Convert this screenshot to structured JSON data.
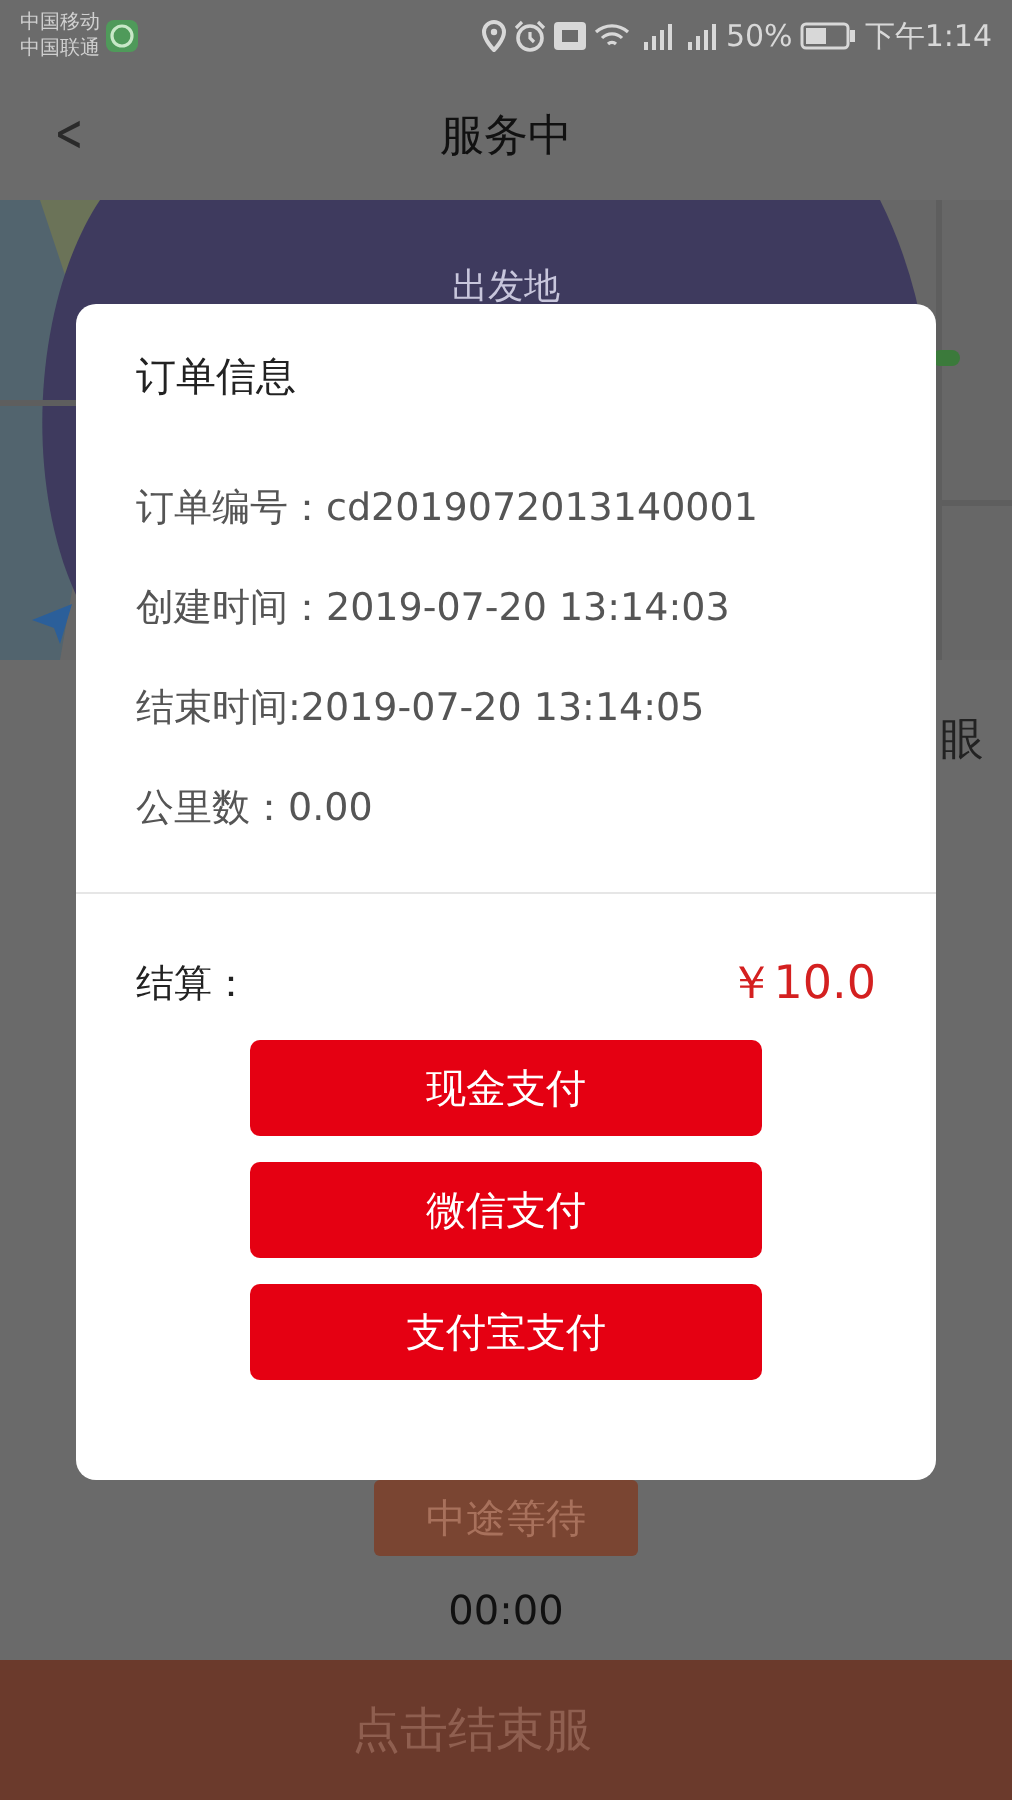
{
  "status_bar": {
    "carriers": [
      "中国移动",
      "中国联通"
    ],
    "battery": "50%",
    "time": "下午1:14"
  },
  "header": {
    "back": "<",
    "title": "服务中"
  },
  "map": {
    "marker_label": "出发地"
  },
  "behind_text": "眼",
  "dialog": {
    "title": "订单信息",
    "rows": [
      "订单编号：cd2019072013140001",
      "创建时间：2019-07-20 13:14:03",
      "结束时间:2019-07-20 13:14:05",
      "公里数：0.00"
    ],
    "total_label": "结算：",
    "total": "￥10.0",
    "buttons": [
      "现金支付",
      "微信支付",
      "支付宝支付"
    ]
  },
  "wait_button": "中途等待",
  "timer": "00:00",
  "end_button": "点击结束服"
}
